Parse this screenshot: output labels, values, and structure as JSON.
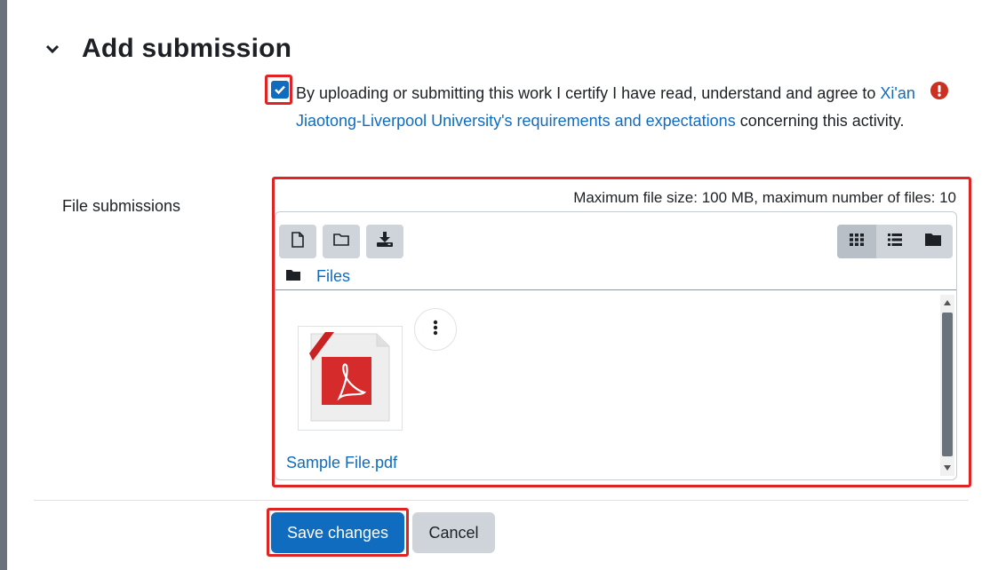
{
  "section": {
    "title": "Add submission"
  },
  "statement": {
    "checked": true,
    "text_before": "By uploading or submitting this work I certify I have read, understand and agree to ",
    "link_text": "Xi'an Jiaotong-Liverpool University's requirements and expectations",
    "text_after": " concerning this activity."
  },
  "file_submissions": {
    "label": "File submissions",
    "max_info": "Maximum file size: 100 MB, maximum number of files: 10",
    "toolbar": {
      "left": [
        "add-file",
        "create-folder",
        "download-all"
      ],
      "views": [
        "icons",
        "details",
        "tree"
      ],
      "active_view": "icons"
    },
    "breadcrumb": "Files",
    "files": [
      {
        "name": "Sample File.pdf",
        "type": "pdf"
      }
    ]
  },
  "actions": {
    "save_label": "Save changes",
    "cancel_label": "Cancel"
  },
  "colors": {
    "accent": "#0f6cbf",
    "highlight": "#e02424",
    "warning": "#ca3120",
    "secondary": "#ced4da"
  }
}
